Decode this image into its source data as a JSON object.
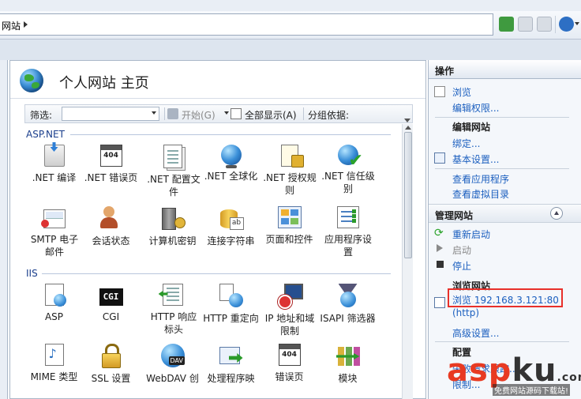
{
  "address": {
    "text": "网站"
  },
  "page": {
    "title": "个人网站 主页"
  },
  "filter": {
    "label": "筛选:",
    "start": "开始(G)",
    "show_all": "全部显示(A)",
    "group_by": "分组依据:"
  },
  "groups": {
    "aspnet": {
      "title": "ASP.NET",
      "items": [
        {
          "label": ".NET 编译",
          "icon": "compile-icon"
        },
        {
          "label": ".NET 错误页",
          "icon": "error-page-icon",
          "badge": "404"
        },
        {
          "label": ".NET 配置文件",
          "icon": "profile-icon"
        },
        {
          "label": ".NET 全球化",
          "icon": "globalization-icon"
        },
        {
          "label": ".NET 授权规则",
          "icon": "authorization-icon"
        },
        {
          "label": ".NET 信任级别",
          "icon": "trust-level-icon"
        },
        {
          "label": "SMTP 电子邮件",
          "icon": "smtp-icon"
        },
        {
          "label": "会话状态",
          "icon": "session-icon"
        },
        {
          "label": "计算机密钥",
          "icon": "machine-key-icon"
        },
        {
          "label": "连接字符串",
          "icon": "connection-string-icon"
        },
        {
          "label": "页面和控件",
          "icon": "pages-controls-icon"
        },
        {
          "label": "应用程序设置",
          "icon": "app-settings-icon"
        }
      ]
    },
    "iis": {
      "title": "IIS",
      "items": [
        {
          "label": "ASP",
          "icon": "asp-icon"
        },
        {
          "label": "CGI",
          "icon": "cgi-icon",
          "badge": "CGI"
        },
        {
          "label": "HTTP 响应标头",
          "icon": "response-headers-icon"
        },
        {
          "label": "HTTP 重定向",
          "icon": "redirect-icon"
        },
        {
          "label": "IP 地址和域限制",
          "icon": "ip-restriction-icon"
        },
        {
          "label": "ISAPI 筛选器",
          "icon": "isapi-filter-icon"
        },
        {
          "label": "MIME 类型",
          "icon": "mime-icon"
        },
        {
          "label": "SSL 设置",
          "icon": "ssl-icon"
        },
        {
          "label": "WebDAV 创",
          "icon": "webdav-icon",
          "badge": "DAV"
        },
        {
          "label": "处理程序映",
          "icon": "handler-icon"
        },
        {
          "label": "错误页",
          "icon": "error-pages-icon",
          "badge": "404"
        },
        {
          "label": "模块",
          "icon": "modules-icon"
        }
      ]
    }
  },
  "actions": {
    "title": "操作",
    "browse": "浏览",
    "edit_permissions": "编辑权限...",
    "edit_site_title": "编辑网站",
    "bindings": "绑定...",
    "basic_settings": "基本设置...",
    "view_apps": "查看应用程序",
    "view_vdirs": "查看虚拟目录",
    "manage_site_title": "管理网站",
    "restart": "重新启动",
    "start": "启动",
    "stop": "停止",
    "browse_site_title": "浏览网站",
    "browse_url": "浏览 192.168.3.121:80",
    "browse_proto": "(http)",
    "advanced": "高级设置...",
    "config_title": "配置",
    "failed_req": "失败请求跟踪...",
    "limits": "限制..."
  },
  "watermark": {
    "logo_a": "asp",
    "logo_b": "ku",
    "logo_c": ".com",
    "sub": "免费网站源码下载站!"
  },
  "colors": {
    "link": "#1b5fbf",
    "highlight": "#e8302a",
    "group": "#1a3e8c"
  }
}
